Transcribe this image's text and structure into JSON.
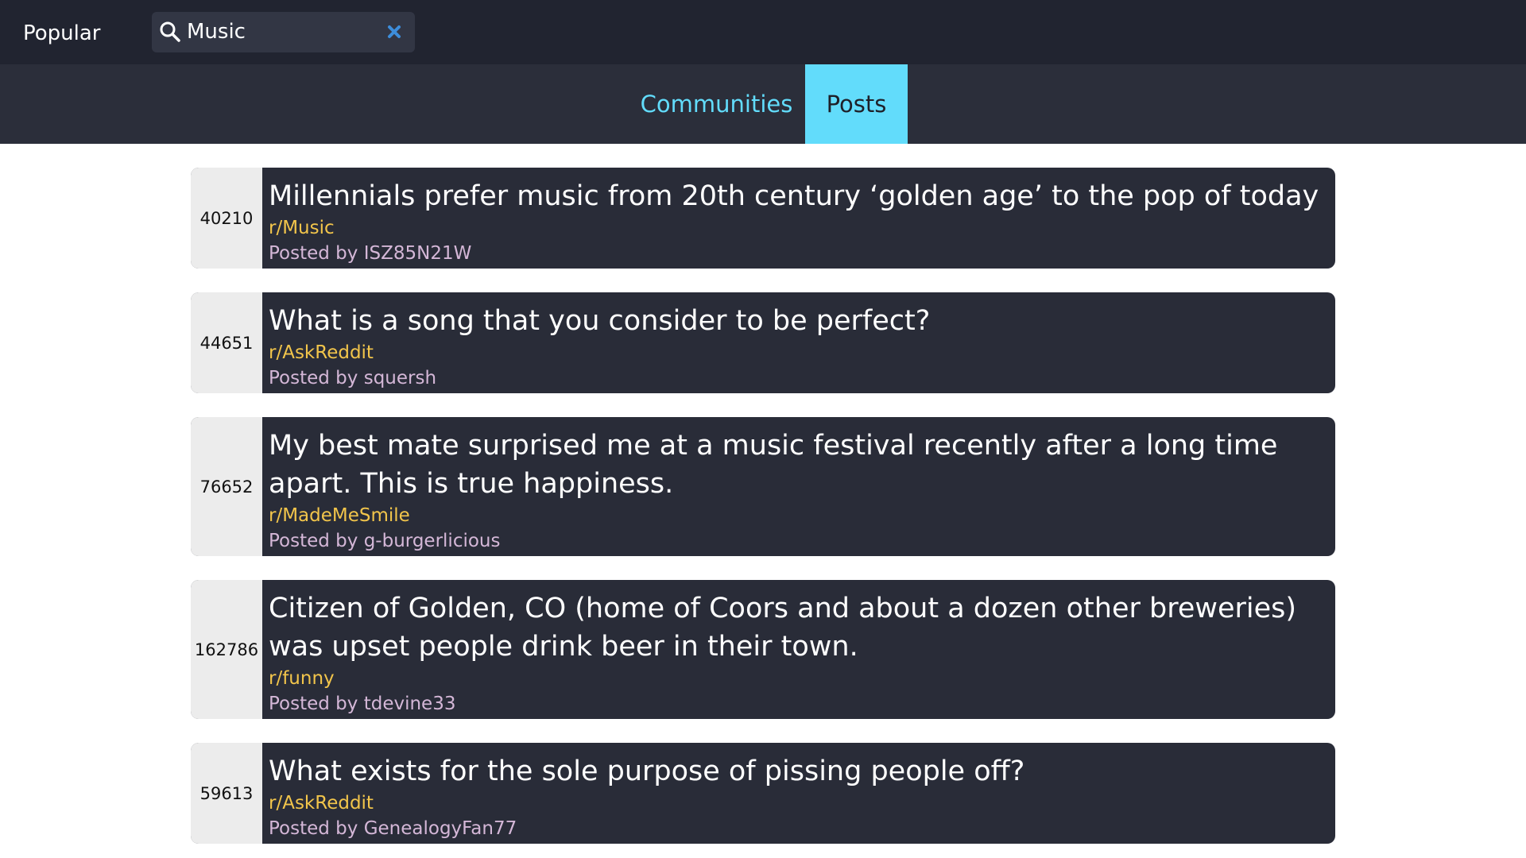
{
  "header": {
    "brand": "Popular",
    "search": {
      "value": "Music",
      "placeholder": ""
    }
  },
  "tabs": [
    {
      "label": "Communities",
      "active": false
    },
    {
      "label": "Posts",
      "active": true
    }
  ],
  "colors": {
    "topbar_bg": "#212430",
    "tabbar_bg": "#2b2e3a",
    "accent_cyan": "#62dcfb",
    "card_bg": "#292c38",
    "score_bg": "#ececec",
    "subreddit": "#f2c54b",
    "author": "#d4b7d7"
  },
  "posts": [
    {
      "score": "40210",
      "title": "Millennials prefer music from 20th century ‘golden age’ to the pop of today",
      "subreddit": "r/Music",
      "author": "Posted by ISZ85N21W"
    },
    {
      "score": "44651",
      "title": "What is a song that you consider to be perfect?",
      "subreddit": "r/AskReddit",
      "author": "Posted by squersh"
    },
    {
      "score": "76652",
      "title": "My best mate surprised me at a music festival recently after a long time apart. This is true happiness.",
      "subreddit": "r/MadeMeSmile",
      "author": "Posted by g-burgerlicious"
    },
    {
      "score": "162786",
      "title": "Citizen of Golden, CO (home of Coors and about a dozen other breweries) was upset people drink beer in their town.",
      "subreddit": "r/funny",
      "author": "Posted by tdevine33"
    },
    {
      "score": "59613",
      "title": "What exists for the sole purpose of pissing people off?",
      "subreddit": "r/AskReddit",
      "author": "Posted by GenealogyFan77"
    }
  ]
}
